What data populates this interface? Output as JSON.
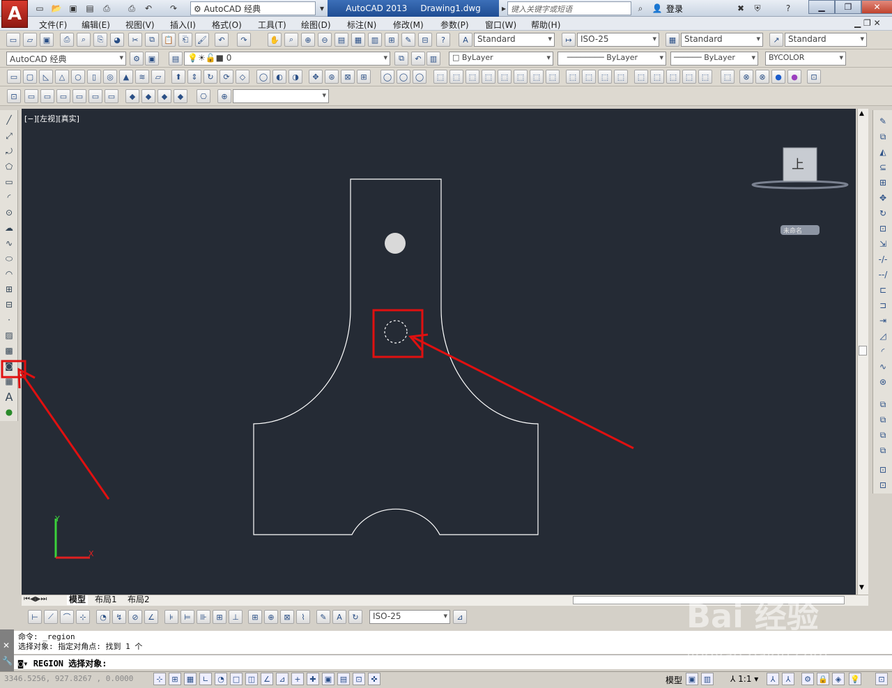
{
  "window": {
    "app_title": "AutoCAD 2013",
    "document_title": "Drawing1.dwg",
    "workspace_title": "AutoCAD 经典",
    "search_placeholder": "键入关键字或短语",
    "login": "登录"
  },
  "menu": [
    "文件(F)",
    "编辑(E)",
    "视图(V)",
    "插入(I)",
    "格式(O)",
    "工具(T)",
    "绘图(D)",
    "标注(N)",
    "修改(M)",
    "参数(P)",
    "窗口(W)",
    "帮助(H)"
  ],
  "toolbar_styles": {
    "text_style": "Standard",
    "dim_style": "ISO-25",
    "table_style": "Standard",
    "mleader_style": "Standard"
  },
  "toolbar_props": {
    "workspace": "AutoCAD 经典",
    "layer": "0",
    "color": "ByLayer",
    "linetype": "ByLayer",
    "lineweight": "ByLayer",
    "plotstyle": "BYCOLOR"
  },
  "viewport": {
    "label": "[−][左视][真实]",
    "viewcube_face": "上",
    "wcs_label": "未命名"
  },
  "tabs": [
    "模型",
    "布局1",
    "布局2"
  ],
  "dim_toolbar": {
    "dim_style": "ISO-25"
  },
  "command": {
    "history": [
      "命令: _region",
      "选择对象: 指定对角点: 找到 1 个"
    ],
    "prompt": "REGION 选择对象:"
  },
  "status": {
    "coords": "3346.5256, 927.8267 , 0.0000",
    "model": "模型",
    "scale": "1:1"
  },
  "watermark": {
    "brand": "Bai 经验",
    "url": "jingyan.baidu.com"
  },
  "colors": {
    "canvas_bg": "#252b35",
    "annotation_red": "#e01010",
    "geometry": "#ffffff"
  }
}
